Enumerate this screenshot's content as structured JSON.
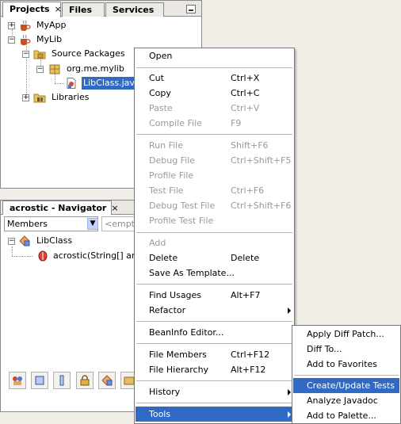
{
  "projects_panel": {
    "tabs": [
      {
        "label": "Projects",
        "active": true,
        "close": "×"
      },
      {
        "label": "Files",
        "active": false
      },
      {
        "label": "Services",
        "active": false
      }
    ],
    "tree": {
      "myapp": "MyApp",
      "mylib": "MyLib",
      "source_packages": "Source Packages",
      "package": "org.me.mylib",
      "libclass_file": "LibClass.java",
      "libraries": "Libraries"
    }
  },
  "navigator_panel": {
    "title": "acrostic - Navigator",
    "close": "×",
    "combo_value": "Members",
    "filter_placeholder": "<empty",
    "tree": {
      "class": "LibClass",
      "method": "acrostic(String[] args"
    }
  },
  "context_menu": {
    "items": [
      {
        "label": "Open",
        "shortcut": "",
        "disabled": false
      },
      {
        "label": "Cut",
        "shortcut": "Ctrl+X",
        "disabled": false
      },
      {
        "label": "Copy",
        "shortcut": "Ctrl+C",
        "disabled": false
      },
      {
        "label": "Paste",
        "shortcut": "Ctrl+V",
        "disabled": true
      },
      {
        "label": "Compile File",
        "shortcut": "F9",
        "disabled": true
      },
      {
        "label": "Run File",
        "shortcut": "Shift+F6",
        "disabled": true
      },
      {
        "label": "Debug File",
        "shortcut": "Ctrl+Shift+F5",
        "disabled": true
      },
      {
        "label": "Profile File",
        "shortcut": "",
        "disabled": true
      },
      {
        "label": "Test File",
        "shortcut": "Ctrl+F6",
        "disabled": true
      },
      {
        "label": "Debug Test File",
        "shortcut": "Ctrl+Shift+F6",
        "disabled": true
      },
      {
        "label": "Profile Test File",
        "shortcut": "",
        "disabled": true
      },
      {
        "label": "Add",
        "shortcut": "",
        "disabled": true
      },
      {
        "label": "Delete",
        "shortcut": "Delete",
        "disabled": false
      },
      {
        "label": "Save As Template...",
        "shortcut": "",
        "disabled": false
      },
      {
        "label": "Find Usages",
        "shortcut": "Alt+F7",
        "disabled": false
      },
      {
        "label": "Refactor",
        "shortcut": "",
        "disabled": false,
        "submenu": true
      },
      {
        "label": "BeanInfo Editor...",
        "shortcut": "",
        "disabled": false
      },
      {
        "label": "File Members",
        "shortcut": "Ctrl+F12",
        "disabled": false
      },
      {
        "label": "File Hierarchy",
        "shortcut": "Alt+F12",
        "disabled": false
      },
      {
        "label": "History",
        "shortcut": "",
        "disabled": false,
        "submenu": true
      },
      {
        "label": "Tools",
        "shortcut": "",
        "disabled": false,
        "submenu": true,
        "highlighted": true
      }
    ]
  },
  "tools_submenu": {
    "items": [
      {
        "label": "Apply Diff Patch..."
      },
      {
        "label": "Diff To..."
      },
      {
        "label": "Add to Favorites"
      },
      {
        "label": "Create/Update Tests",
        "highlighted": true
      },
      {
        "label": "Analyze Javadoc"
      },
      {
        "label": "Add to Palette..."
      }
    ]
  },
  "colors": {
    "selection": "#316ac5",
    "disabled_text": "#9a9a9a",
    "panel_bg": "#f0eee6"
  }
}
